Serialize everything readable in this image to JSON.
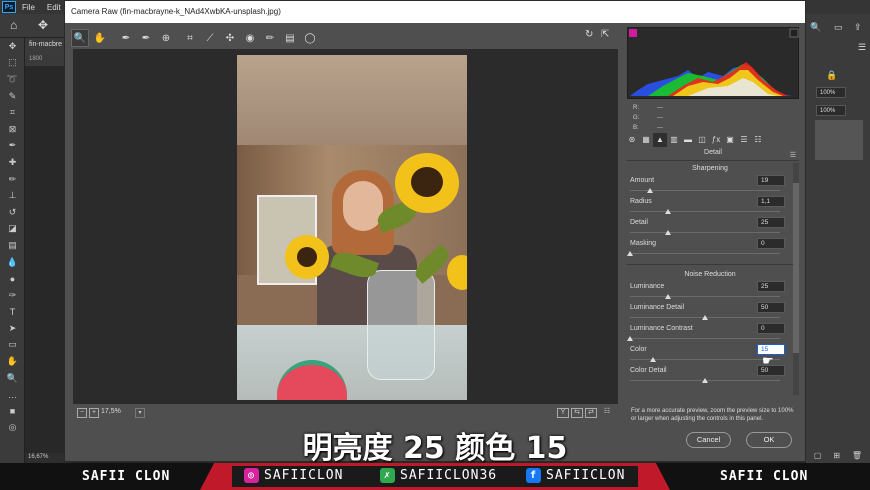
{
  "ps": {
    "logo": "Ps",
    "menus": [
      "File",
      "Edit"
    ],
    "doc_tab": "fin-macbre",
    "ruler": "1800",
    "zoom": "16,67%",
    "right_pct1": "100%",
    "right_pct2": "100%"
  },
  "dialog": {
    "title": "Camera Raw (fin-macbrayne-k_NAd4XwbKA-unsplash.jpg)",
    "zoom_level": "17,5%",
    "panel_title": "Detail",
    "rgb": {
      "r_label": "R:",
      "g_label": "G:",
      "b_label": "B:",
      "r": "---",
      "g": "---",
      "b": "---"
    },
    "sharpening": {
      "heading": "Sharpening",
      "rows": [
        {
          "label": "Amount",
          "value": "19",
          "level": 0.13
        },
        {
          "label": "Radius",
          "value": "1,1",
          "level": 0.25
        },
        {
          "label": "Detail",
          "value": "25",
          "level": 0.25
        },
        {
          "label": "Masking",
          "value": "0",
          "level": 0.0
        }
      ]
    },
    "noise": {
      "heading": "Noise Reduction",
      "rows": [
        {
          "label": "Luminance",
          "value": "25",
          "level": 0.25
        },
        {
          "label": "Luminance Detail",
          "value": "50",
          "level": 0.5
        },
        {
          "label": "Luminance Contrast",
          "value": "0",
          "level": 0.0
        },
        {
          "label": "Color",
          "value": "15",
          "level": 0.15
        },
        {
          "label": "Color Detail",
          "value": "50",
          "level": 0.5
        }
      ]
    },
    "note": "For a more accurate preview, zoom the preview size to 100% or larger when adjusting the controls in this panel.",
    "cancel": "Cancel",
    "ok": "OK"
  },
  "subtitle": "明亮度 25 颜色 15",
  "banner": {
    "left": "SAFII CLON",
    "right": "SAFII CLON",
    "instagram": "SAFIICLON",
    "other": "SAFIICLON36",
    "facebook": "SAFIICLON",
    "colors": {
      "red": "#c01a2a",
      "instagram": "#d6249f",
      "green": "#2fa84f",
      "facebook": "#1877f2"
    }
  }
}
